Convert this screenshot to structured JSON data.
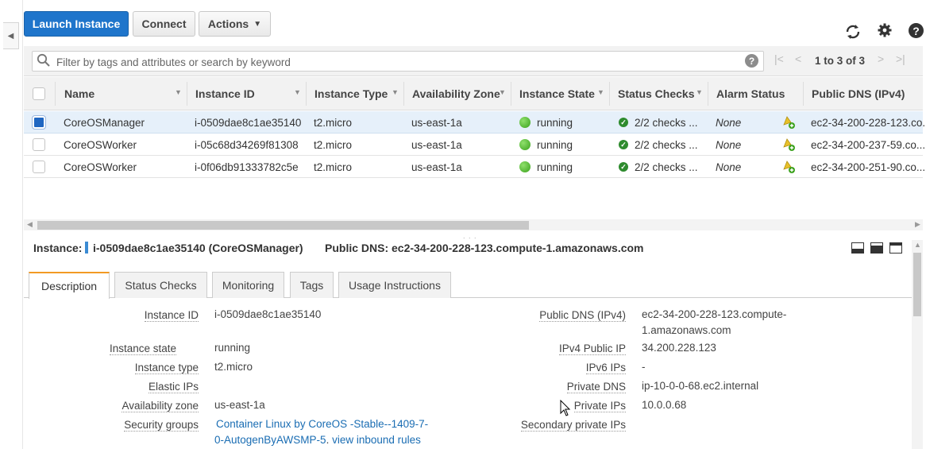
{
  "toolbar": {
    "launch_label": "Launch Instance",
    "connect_label": "Connect",
    "actions_label": "Actions"
  },
  "icons": {
    "refresh": "refresh-icon",
    "settings": "gear-icon",
    "help": "help-icon",
    "search": "search-icon"
  },
  "search": {
    "placeholder": "Filter by tags and attributes or search by keyword"
  },
  "pagination": {
    "text": "1 to 3 of 3"
  },
  "table": {
    "columns": [
      "Name",
      "Instance ID",
      "Instance Type",
      "Availability Zone",
      "Instance State",
      "Status Checks",
      "Alarm Status",
      "Public DNS (IPv4)"
    ],
    "rows": [
      {
        "selected": true,
        "name": "CoreOSManager",
        "id": "i-0509dae8c1ae35140",
        "type": "t2.micro",
        "az": "us-east-1a",
        "state": "running",
        "checks": "2/2 checks ...",
        "alarm": "None",
        "dns": "ec2-34-200-228-123.co..."
      },
      {
        "selected": false,
        "name": "CoreOSWorker",
        "id": "i-05c68d34269f81308",
        "type": "t2.micro",
        "az": "us-east-1a",
        "state": "running",
        "checks": "2/2 checks ...",
        "alarm": "None",
        "dns": "ec2-34-200-237-59.co..."
      },
      {
        "selected": false,
        "name": "CoreOSWorker",
        "id": "i-0f06db91333782c5e",
        "type": "t2.micro",
        "az": "us-east-1a",
        "state": "running",
        "checks": "2/2 checks ...",
        "alarm": "None",
        "dns": "ec2-34-200-251-90.co..."
      }
    ]
  },
  "detail": {
    "instance_label": "Instance:",
    "instance_value": "i-0509dae8c1ae35140 (CoreOSManager)",
    "dns_header": "Public DNS: ec2-34-200-228-123.compute-1.amazonaws.com",
    "tabs": [
      "Description",
      "Status Checks",
      "Monitoring",
      "Tags",
      "Usage Instructions"
    ],
    "left": [
      {
        "label": "Instance ID",
        "value": "i-0509dae8c1ae35140"
      },
      {
        "label": "Instance state",
        "value": "running"
      },
      {
        "label": "Instance type",
        "value": "t2.micro"
      },
      {
        "label": "Elastic IPs",
        "value": ""
      },
      {
        "label": "Availability zone",
        "value": "us-east-1a"
      },
      {
        "label": "Security groups",
        "value_line1": "Container Linux by CoreOS -Stable--1409-7-",
        "value_line2": "0-AutogenByAWSMP-5",
        "value_sep": ". ",
        "value_link2": "view inbound rules"
      }
    ],
    "right": [
      {
        "label": "Public DNS (IPv4)",
        "value_line1": "ec2-34-200-228-123.compute-",
        "value_line2": "1.amazonaws.com"
      },
      {
        "label": "IPv4 Public IP",
        "value": "34.200.228.123"
      },
      {
        "label": "IPv6 IPs",
        "value": "-"
      },
      {
        "label": "Private DNS",
        "value": "ip-10-0-0-68.ec2.internal"
      },
      {
        "label": "Private IPs",
        "value": "10.0.0.68"
      },
      {
        "label": "Secondary private IPs",
        "value": ""
      }
    ]
  },
  "colors": {
    "primary": "#1f75cb",
    "running": "#3aa11c",
    "link": "#1a6db3",
    "active_tab_accent": "#f29a24"
  }
}
